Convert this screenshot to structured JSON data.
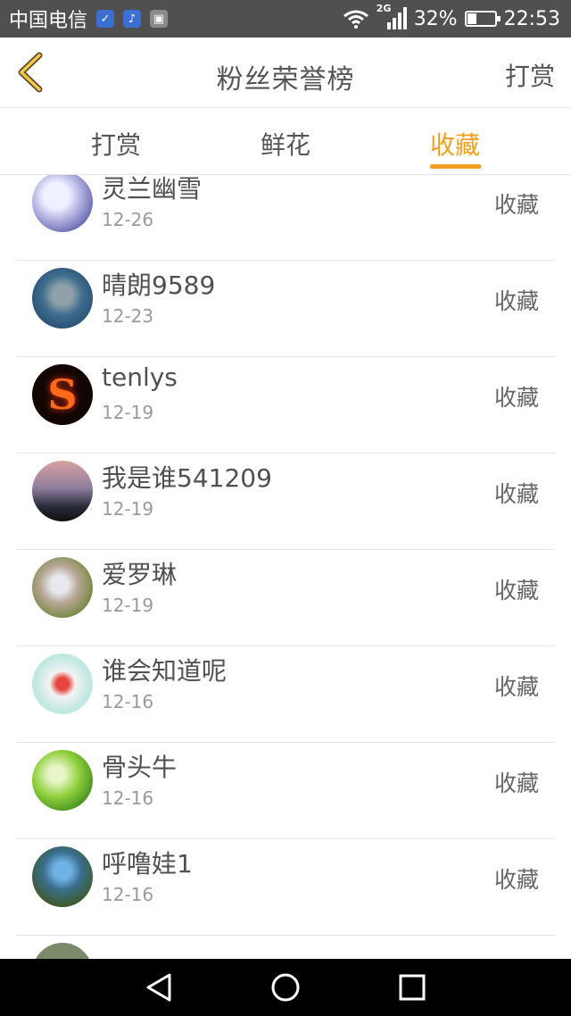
{
  "status_bar": {
    "carrier": "中国电信",
    "network": "2G",
    "battery_percent_text": "32%",
    "battery_level": 0.32,
    "time": "22:53"
  },
  "header": {
    "title": "粉丝荣誉榜",
    "right_action": "打赏",
    "back_icon": "chevron-left-icon"
  },
  "tabs": [
    {
      "label": "打赏",
      "active": false
    },
    {
      "label": "鲜花",
      "active": false
    },
    {
      "label": "收藏",
      "active": true
    }
  ],
  "colors": {
    "accent": "#f0a01e",
    "text": "#555555",
    "muted": "#9a9a9a",
    "statusbar": "#505050",
    "navbar": "#000000"
  },
  "fans": [
    {
      "name": "灵兰幽雪",
      "date": "12-26",
      "action": "收藏"
    },
    {
      "name": "晴朗9589",
      "date": "12-23",
      "action": "收藏"
    },
    {
      "name": "tenlys",
      "date": "12-19",
      "action": "收藏"
    },
    {
      "name": "我是谁541209",
      "date": "12-19",
      "action": "收藏"
    },
    {
      "name": "爱罗琳",
      "date": "12-19",
      "action": "收藏"
    },
    {
      "name": "谁会知道呢",
      "date": "12-16",
      "action": "收藏"
    },
    {
      "name": "骨头牛",
      "date": "12-16",
      "action": "收藏"
    },
    {
      "name": "呼噜娃1",
      "date": "12-16",
      "action": "收藏"
    }
  ],
  "nav": {
    "back": "triangle-back-icon",
    "home": "circle-home-icon",
    "recent": "square-recent-icon"
  }
}
